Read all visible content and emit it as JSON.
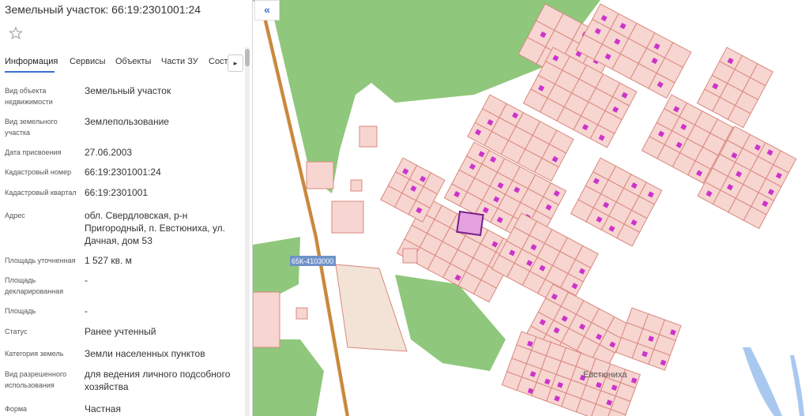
{
  "panel": {
    "title": "Земельный участок: 66:19:2301001:24",
    "tabs": [
      "Информация",
      "Сервисы",
      "Объекты",
      "Части ЗУ",
      "Соста"
    ],
    "tabs_next": "▸",
    "rows": [
      {
        "label": "Вид объекта недвижимости",
        "value": "Земельный участок"
      },
      {
        "label": "Вид земельного участка",
        "value": "Землепользование"
      },
      {
        "label": "Дата присвоения",
        "value": "27.06.2003"
      },
      {
        "label": "Кадастровый номер",
        "value": "66:19:2301001:24"
      },
      {
        "label": "Кадастровый квартал",
        "value": "66:19:2301001"
      },
      {
        "label": "Адрес",
        "value": "обл. Свердловская, р-н Пригородный, п. Евстюниха, ул. Дачная, дом 53"
      },
      {
        "label": "Площадь уточненная",
        "value": "1 527 кв. м"
      },
      {
        "label": "Площадь декларированная",
        "value": "-"
      },
      {
        "label": "Площадь",
        "value": "-"
      },
      {
        "label": "Статус",
        "value": "Ранее учтенный"
      },
      {
        "label": "Категория земель",
        "value": "Земли населенных пунктов"
      },
      {
        "label": "Вид разрешенного использования",
        "value": "для ведения личного подсобного хозяйства"
      },
      {
        "label": "Форма собственности",
        "value": "Частная"
      }
    ]
  },
  "map": {
    "road_label": "65К-4103000",
    "place_label": "Евстюниха",
    "collapse_label": "«",
    "colors": {
      "background": "#ffffff",
      "forest": "#8fc77c",
      "parcel_fill": "#f7d5d0",
      "parcel_stroke": "#d9897f",
      "building": "#cc33cc",
      "road": "#c8873a",
      "selected_parcel": "#7a1f88",
      "water": "#a9c8f0",
      "road_label_bg": "#6f93c8"
    }
  }
}
